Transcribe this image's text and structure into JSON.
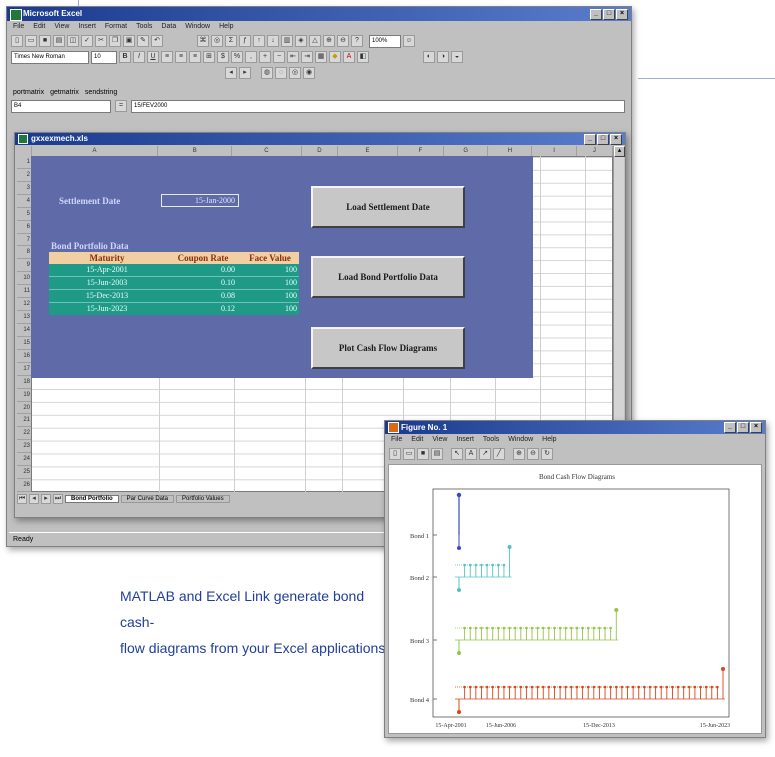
{
  "excel": {
    "title": "Microsoft Excel",
    "menu": [
      "File",
      "Edit",
      "View",
      "Insert",
      "Format",
      "Tools",
      "Data",
      "Window",
      "Help"
    ],
    "font_name": "Times New Roman",
    "font_size": "10",
    "zoom": "100%",
    "addin_menu": [
      "portmatrix",
      "getmatrix",
      "sendstring"
    ],
    "name_box": "B4",
    "formula_value": "15/FEV2000",
    "status": "Ready",
    "sheet_tabs": [
      "Bond Portfolio",
      "Par Curve Data",
      "Portfolio Values"
    ]
  },
  "workbook": {
    "title": "gxxexmech.xls",
    "columns": [
      "A",
      "B",
      "C",
      "D",
      "E",
      "F",
      "G",
      "H",
      "I",
      "J"
    ],
    "rows": [
      "1",
      "2",
      "3",
      "4",
      "5",
      "6",
      "7",
      "8",
      "9",
      "10",
      "11",
      "12",
      "13",
      "14",
      "15",
      "16",
      "17",
      "18",
      "19",
      "20",
      "21",
      "22",
      "23",
      "24",
      "25",
      "26"
    ],
    "settlement_label": "Settlement Date",
    "settlement_value": "15-Jan-2000",
    "portfolio_label": "Bond Portfolio Data",
    "table_headers": [
      "Maturity",
      "Coupon Rate",
      "Face Value"
    ],
    "table_rows": [
      [
        "15-Apr-2001",
        "0.00",
        "100"
      ],
      [
        "15-Jun-2003",
        "0.10",
        "100"
      ],
      [
        "15-Dec-2013",
        "0.08",
        "100"
      ],
      [
        "15-Jun-2023",
        "0.12",
        "100"
      ]
    ],
    "buttons": [
      "Load Settlement Date",
      "Load Bond Portfolio Data",
      "Plot Cash Flow Diagrams"
    ]
  },
  "figure": {
    "title": "Figure No. 1",
    "menu": [
      "File",
      "Edit",
      "View",
      "Insert",
      "Tools",
      "Window",
      "Help"
    ],
    "chart_data": {
      "type": "cash-flow stem diagram",
      "title": "Bond Cash Flow Diagrams",
      "categories": [
        "Bond 1",
        "Bond 2",
        "Bond 3",
        "Bond 4"
      ],
      "x_tick_labels": [
        "15-Apr-2001",
        "15-Jun-2006",
        "15-Dec-2013",
        "15-Jun-2023"
      ],
      "grid": false,
      "series": [
        {
          "name": "Bond 1",
          "color": "#3a46c8",
          "periods": 1
        },
        {
          "name": "Bond 2",
          "color": "#55c1c4",
          "periods": 9
        },
        {
          "name": "Bond 3",
          "color": "#93c447",
          "periods": 28
        },
        {
          "name": "Bond 4",
          "color": "#d7461a",
          "periods": 47
        }
      ]
    }
  },
  "caption": {
    "line1": "MATLAB and Excel Link generate bond cash-",
    "line2": "flow diagrams from your Excel applications."
  }
}
